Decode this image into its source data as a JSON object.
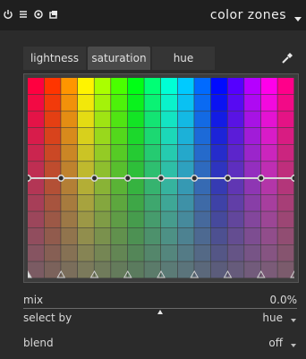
{
  "header": {
    "title": "color zones",
    "icons": [
      "power-icon",
      "presets-icon",
      "instance-icon",
      "reset-icon",
      "collapse-chevron-icon"
    ]
  },
  "tabs": [
    {
      "label": "lightness",
      "active": false
    },
    {
      "label": "saturation",
      "active": true
    },
    {
      "label": "hue",
      "active": false
    }
  ],
  "controls": {
    "mix": {
      "label": "mix",
      "value": "0.0%",
      "position": 0.5
    },
    "select_by": {
      "label": "select by",
      "value": "hue"
    },
    "blend": {
      "label": "blend",
      "value": "off"
    }
  },
  "curve": {
    "level": 0.5,
    "node_count": 9
  },
  "colors": {
    "background": "#2b2b2b",
    "header": "#1f1f1f",
    "active_tab": "#4a4a4a",
    "curve": "#d8d8d8"
  }
}
